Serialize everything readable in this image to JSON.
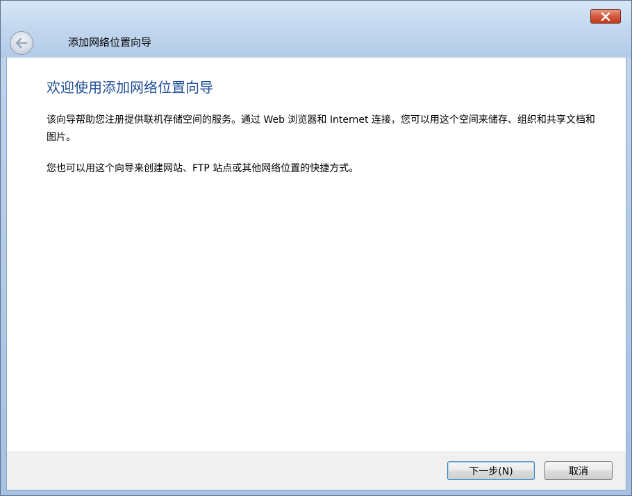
{
  "window": {
    "title": "添加网络位置向导"
  },
  "icons": {
    "back": "back-arrow-icon",
    "close": "close-x-icon"
  },
  "content": {
    "heading": "欢迎使用添加网络位置向导",
    "paragraph1": "该向导帮助您注册提供联机存储空间的服务。通过 Web 浏览器和 Internet 连接，您可以用这个空间来储存、组织和共享文档和图片。",
    "paragraph2": "您也可以用这个向导来创建网站、FTP 站点或其他网络位置的快捷方式。"
  },
  "buttons": {
    "next": "下一步(N)",
    "cancel": "取消"
  },
  "colors": {
    "heading": "#1f4e99",
    "close_button": "#d5583c",
    "frame": "#b3cbe7"
  }
}
